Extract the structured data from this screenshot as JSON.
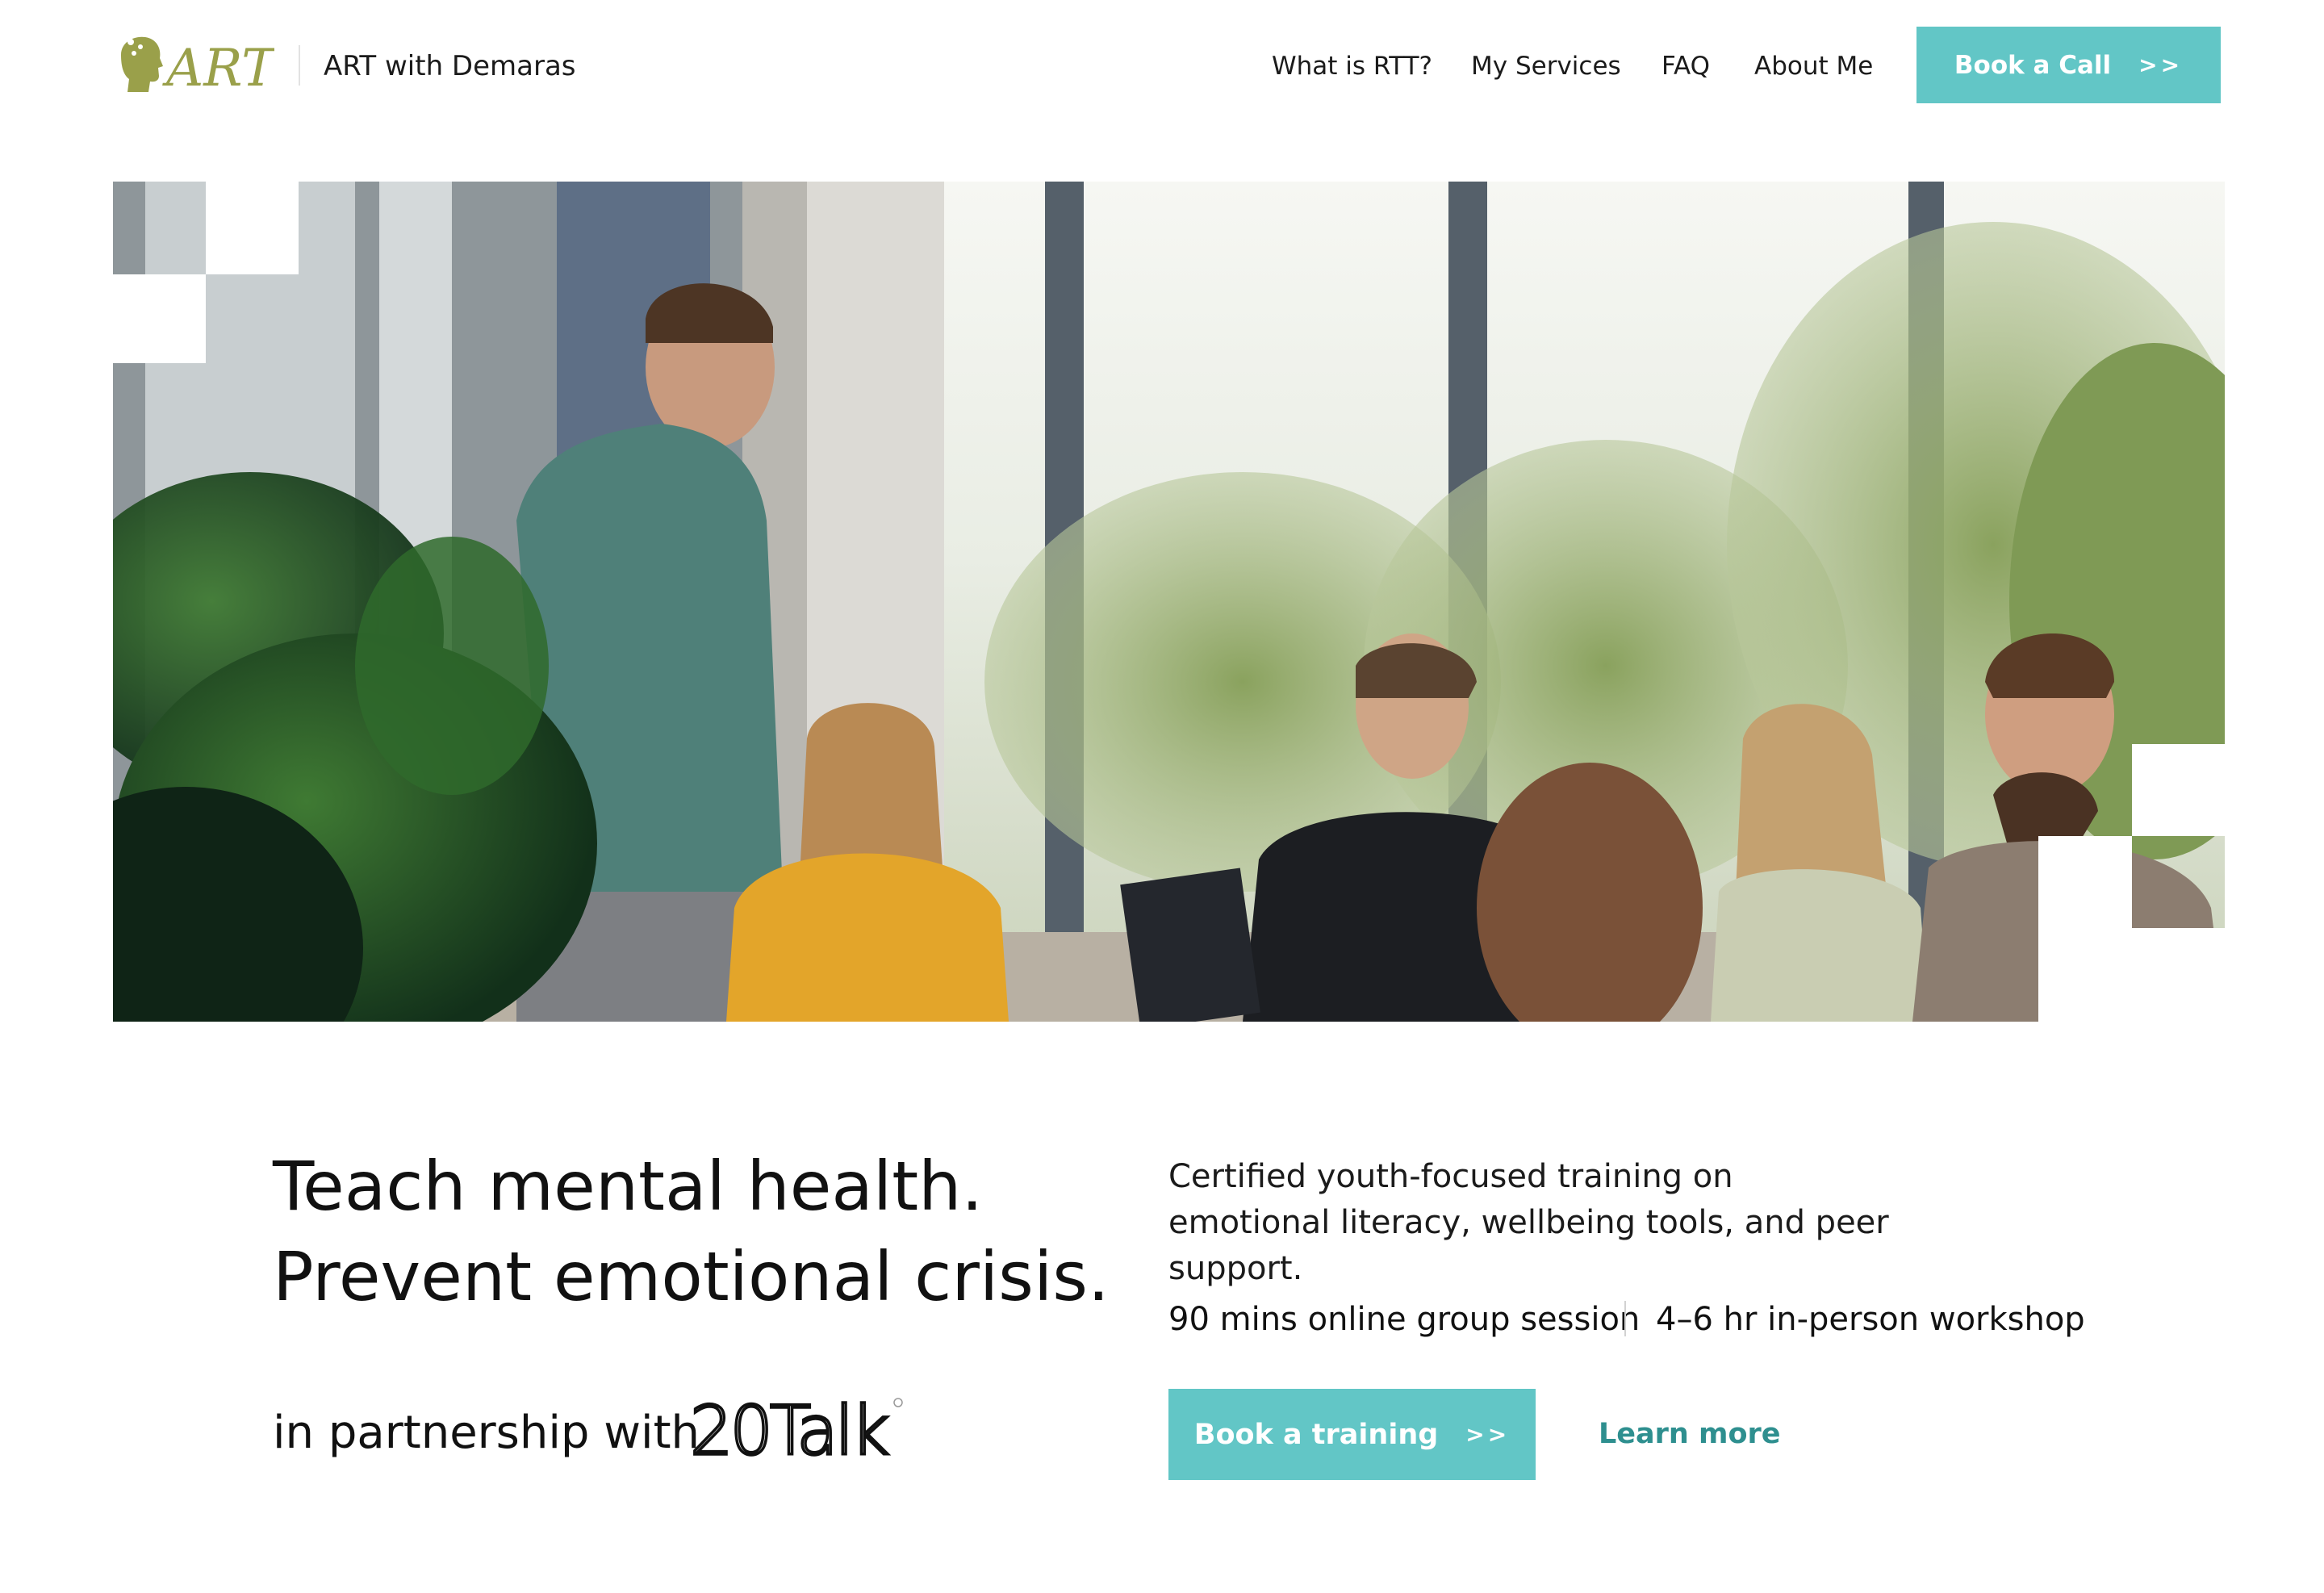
{
  "header": {
    "logo_text": "ART",
    "brand_name": "ART with Demaras",
    "nav": [
      {
        "label": "What is RTT?"
      },
      {
        "label": "My Services"
      },
      {
        "label": "FAQ"
      },
      {
        "label": "About Me"
      }
    ],
    "cta_label": "Book a Call",
    "cta_chevron": ">>"
  },
  "hero": {
    "image": "group-workshop-photo"
  },
  "main": {
    "headline_line1": "Teach mental health.",
    "headline_line2": "Prevent emotional crisis.",
    "partnership_text": "in partnership with",
    "partner_logo_text": "20Talk",
    "description": "Certified youth-focused training on emotional literacy, wellbeing tools, and peer support.",
    "formats": [
      "90 mins online group session",
      "4–6 hr in-person workshop"
    ],
    "primary_cta": "Book a training",
    "primary_cta_chevron": ">>",
    "secondary_cta": "Learn more"
  },
  "colors": {
    "accent": "#62c6c6",
    "link": "#2e8f8f",
    "logo": "#9aa04a",
    "text": "#111111"
  }
}
